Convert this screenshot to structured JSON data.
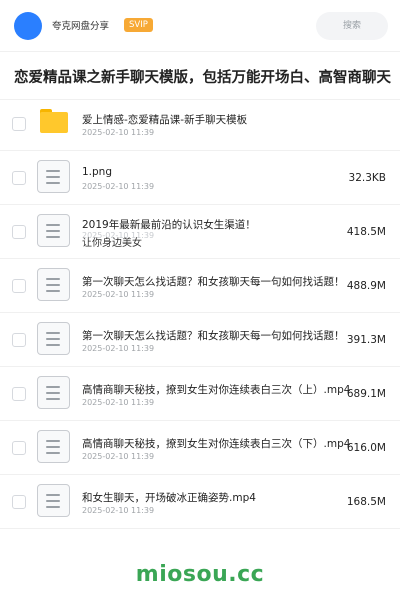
{
  "header": {
    "title": "夸克网盘分享",
    "badge": "SVIP",
    "search_placeholder": "搜索"
  },
  "page_title": "恋爱精品课之新手聊天模版，包括万能开场白、高智商聊天",
  "files": [
    {
      "type": "folder",
      "name": "爱上情感-恋爱精品课-新手聊天模板",
      "date": "2025-02-10 11:39",
      "size": ""
    },
    {
      "type": "file",
      "name": "1.png",
      "date": "2025-02-10 11:39",
      "size": "32.3KB"
    },
    {
      "type": "file",
      "name": "2019年最新最前沿的认识女生渠道！",
      "subline": "让你身边美女",
      "date": "2025-02-10 11:39",
      "size": "418.5M"
    },
    {
      "type": "file",
      "name": "第一次聊天怎么找话题？和女孩聊天每一句如何找话题！",
      "date": "2025-02-10 11:39",
      "size": "488.9M"
    },
    {
      "type": "file",
      "name": "第一次聊天怎么找话题？和女孩聊天每一句如何找话题！",
      "date": "2025-02-10 11:39",
      "size": "391.3M"
    },
    {
      "type": "file",
      "name": "高情商聊天秘技，撩到女生对你连续表白三次（上）.mp4",
      "date": "2025-02-10 11:39",
      "size": "689.1M"
    },
    {
      "type": "file",
      "name": "高情商聊天秘技，撩到女生对你连续表白三次（下）.mp4",
      "date": "2025-02-10 11:39",
      "size": "616.0M"
    },
    {
      "type": "file",
      "name": "和女生聊天，开场破冰正确姿势.mp4",
      "date": "2025-02-10 11:39",
      "size": "168.5M"
    }
  ],
  "watermark": "miosou.cc"
}
